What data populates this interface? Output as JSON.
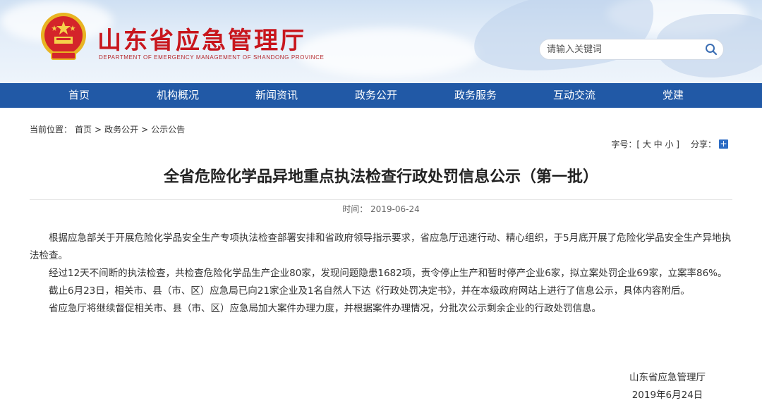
{
  "header": {
    "site_title": "山东省应急管理厅",
    "site_subtitle": "DEPARTMENT OF EMERGENCY MANAGEMENT OF SHANDONG PROVINCE",
    "search_placeholder": "请输入关键词",
    "emblem_icon": "national-emblem-icon",
    "search_icon": "search-icon"
  },
  "nav": {
    "items": [
      "首页",
      "机构概况",
      "新闻资讯",
      "政务公开",
      "政务服务",
      "互动交流",
      "党建"
    ]
  },
  "breadcrumb": {
    "label": "当前位置：",
    "items": [
      "首页",
      "政务公开",
      "公示公告"
    ],
    "separator": ">"
  },
  "tools": {
    "font_size_label": "字号：[ 大 中 小 ]",
    "share_label": "分享：",
    "share_icon": "plus-icon"
  },
  "article": {
    "title": "全省危险化学品异地重点执法检查行政处罚信息公示（第一批）",
    "meta": "时间： 2019-06-24",
    "paragraphs": [
      "根据应急部关于开展危险化学品安全生产专项执法检查部署安排和省政府领导指示要求，省应急厅迅速行动、精心组织，于5月底开展了危险化学品安全生产异地执法检查。",
      "经过12天不间断的执法检查，共检查危险化学品生产企业80家，发现问题隐患1682项，责令停止生产和暂时停产企业6家，拟立案处罚企业69家，立案率86%。",
      "截止6月23日，相关市、县（市、区）应急局已向21家企业及1名自然人下达《行政处罚决定书》，并在本级政府网站上进行了信息公示，具体内容附后。",
      "省应急厅将继续督促相关市、县（市、区）应急局加大案件办理力度，并根据案件办理情况，分批次公示剩余企业的行政处罚信息。"
    ],
    "signature": "山东省应急管理厅",
    "date": "2019年6月24日"
  },
  "colors": {
    "nav_bg": "#2159a6",
    "title_red": "#c8161d"
  }
}
